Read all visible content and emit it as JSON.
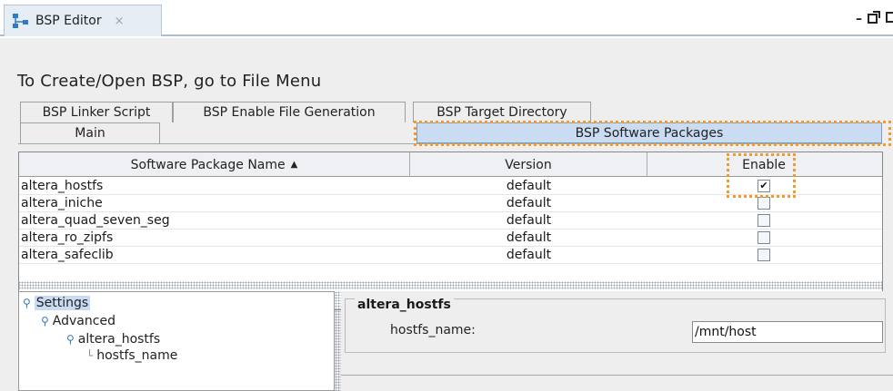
{
  "editor": {
    "tab_title": "BSP Editor",
    "close_icon": "×",
    "minimize": "–",
    "maximize_icon": "maximize-icon"
  },
  "header": {
    "title": "To Create/Open BSP, go to File Menu"
  },
  "subtabs": {
    "row1": [
      "BSP Linker Script",
      "BSP Enable File Generation",
      "BSP Target Directory"
    ],
    "row2": [
      "Main",
      "BSP Software Packages"
    ]
  },
  "table": {
    "columns": [
      "Software Package Name",
      "Version",
      "Enable"
    ],
    "sort_icon": "▲",
    "rows": [
      {
        "name": "altera_hostfs",
        "version": "default",
        "enabled": true
      },
      {
        "name": "altera_iniche",
        "version": "default",
        "enabled": false
      },
      {
        "name": "altera_quad_seven_seg",
        "version": "default",
        "enabled": false
      },
      {
        "name": "altera_ro_zipfs",
        "version": "default",
        "enabled": false
      },
      {
        "name": "altera_safeclib",
        "version": "default",
        "enabled": false
      }
    ]
  },
  "tree": {
    "nodes": [
      "Settings",
      "Advanced",
      "altera_hostfs",
      "hostfs_name"
    ]
  },
  "settings": {
    "group_title": "altera_hostfs",
    "field_label": "hostfs_name:",
    "field_value": "/mnt/host"
  },
  "colors": {
    "highlight": "#f39a2e",
    "active_tab": "#c9dcf2"
  }
}
